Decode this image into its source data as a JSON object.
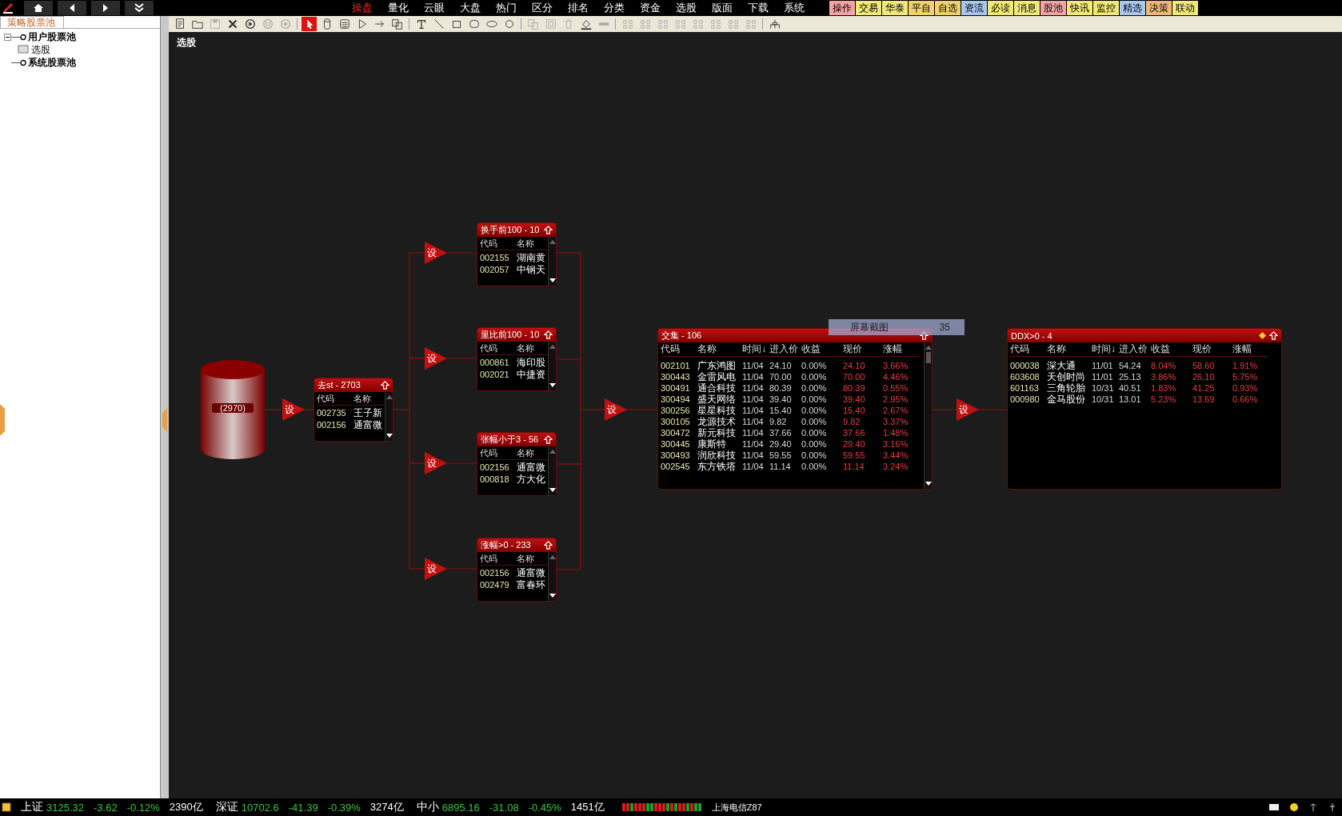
{
  "menu": {
    "items": [
      {
        "label": "操盘",
        "selected": true
      },
      {
        "label": "量化",
        "selected": false
      },
      {
        "label": "云眼",
        "selected": false
      },
      {
        "label": "大盘",
        "selected": false
      },
      {
        "label": "热门",
        "selected": false
      },
      {
        "label": "区分",
        "selected": false
      },
      {
        "label": "排名",
        "selected": false
      },
      {
        "label": "分类",
        "selected": false
      },
      {
        "label": "资金",
        "selected": false
      },
      {
        "label": "选股",
        "selected": false
      },
      {
        "label": "版面",
        "selected": false
      },
      {
        "label": "下载",
        "selected": false
      },
      {
        "label": "系统",
        "selected": false
      }
    ]
  },
  "quick_tabs": [
    {
      "label": "操作",
      "color": "#f4a4a4"
    },
    {
      "label": "交易",
      "color": "#f0e878"
    },
    {
      "label": "华泰",
      "color": "#f0e878"
    },
    {
      "label": "平自",
      "color": "#f0d070"
    },
    {
      "label": "自选",
      "color": "#f0d070"
    },
    {
      "label": "资流",
      "color": "#a8c8f0"
    },
    {
      "label": "必读",
      "color": "#f0e878"
    },
    {
      "label": "消息",
      "color": "#f0e878"
    },
    {
      "label": "股池",
      "color": "#f4a4a4"
    },
    {
      "label": "快讯",
      "color": "#f0e878"
    },
    {
      "label": "监控",
      "color": "#f0e878"
    },
    {
      "label": "精选",
      "color": "#a8c8f0"
    },
    {
      "label": "决策",
      "color": "#f0b878"
    },
    {
      "label": "联动",
      "color": "#f0e878"
    }
  ],
  "sidebar": {
    "tab": "策略股票池",
    "tree": [
      {
        "label": "用户股票池",
        "expanded": true,
        "children": [
          {
            "label": "选股"
          }
        ]
      },
      {
        "label": "系统股票池"
      }
    ]
  },
  "toolbar": {
    "tools": [
      {
        "kind": "new",
        "selected": false,
        "disabled": false
      },
      {
        "kind": "open",
        "selected": false,
        "disabled": false
      },
      {
        "kind": "save",
        "selected": false,
        "disabled": true
      },
      {
        "kind": "close",
        "selected": false,
        "disabled": false
      },
      {
        "kind": "run",
        "selected": false,
        "disabled": false
      },
      {
        "kind": "pause",
        "selected": false,
        "disabled": true
      },
      {
        "kind": "stop",
        "selected": false,
        "disabled": true
      },
      {
        "kind": "pointer",
        "selected": true,
        "disabled": false
      },
      {
        "kind": "cylinder",
        "selected": false,
        "disabled": false
      },
      {
        "kind": "list",
        "selected": false,
        "disabled": false
      },
      {
        "kind": "triangle",
        "selected": false,
        "disabled": false
      },
      {
        "kind": "arrow",
        "selected": false,
        "disabled": false
      },
      {
        "kind": "copy",
        "selected": false,
        "disabled": false
      },
      {
        "kind": "text",
        "selected": false,
        "disabled": false
      },
      {
        "kind": "line",
        "selected": false,
        "disabled": false
      },
      {
        "kind": "rect",
        "selected": false,
        "disabled": false
      },
      {
        "kind": "roundrect",
        "selected": false,
        "disabled": false
      },
      {
        "kind": "ellipse",
        "selected": false,
        "disabled": false
      },
      {
        "kind": "circle",
        "selected": false,
        "disabled": false
      },
      {
        "kind": "copy",
        "selected": false,
        "disabled": true
      },
      {
        "kind": "paste",
        "selected": false,
        "disabled": true
      },
      {
        "kind": "delete",
        "selected": false,
        "disabled": true
      },
      {
        "kind": "fill",
        "selected": false,
        "disabled": false
      },
      {
        "kind": "bar",
        "selected": false,
        "disabled": true
      },
      {
        "kind": "align",
        "selected": false,
        "disabled": true
      },
      {
        "kind": "align",
        "selected": false,
        "disabled": true
      },
      {
        "kind": "align",
        "selected": false,
        "disabled": true
      },
      {
        "kind": "align",
        "selected": false,
        "disabled": true
      },
      {
        "kind": "align",
        "selected": false,
        "disabled": true
      },
      {
        "kind": "align",
        "selected": false,
        "disabled": true
      },
      {
        "kind": "align",
        "selected": false,
        "disabled": true
      },
      {
        "kind": "align",
        "selected": false,
        "disabled": true
      },
      {
        "kind": "tree",
        "selected": false,
        "disabled": false
      }
    ]
  },
  "canvas": {
    "title": "选股"
  },
  "diagram": {
    "nodes": [
      {
        "kind": "source",
        "label": "(2970)"
      },
      {
        "kind": "gate",
        "label": "设"
      },
      {
        "kind": "list",
        "title": "去st - 2703",
        "columns": [
          "代码",
          "名称"
        ],
        "rows": [
          [
            "002735",
            "王子新"
          ],
          [
            "002156",
            "通富微"
          ]
        ]
      },
      {
        "kind": "gate",
        "label": "设"
      },
      {
        "kind": "list",
        "title": "换手前100 - 10",
        "columns": [
          "代码",
          "名称"
        ],
        "rows": [
          [
            "002155",
            "湖南黄"
          ],
          [
            "002057",
            "中钢天"
          ]
        ]
      },
      {
        "kind": "gate",
        "label": "设"
      },
      {
        "kind": "list",
        "title": "里比前100 - 10",
        "columns": [
          "代码",
          "名称"
        ],
        "rows": [
          [
            "000861",
            "海印股"
          ],
          [
            "002021",
            "中捷资"
          ]
        ]
      },
      {
        "kind": "gate",
        "label": "设"
      },
      {
        "kind": "list",
        "title": "张幅小于3 - 56",
        "columns": [
          "代码",
          "名称"
        ],
        "rows": [
          [
            "002156",
            "通富微"
          ],
          [
            "000818",
            "方大化"
          ]
        ]
      },
      {
        "kind": "gate",
        "label": "设"
      },
      {
        "kind": "list",
        "title": "涨幅>0 - 233",
        "columns": [
          "代码",
          "名称"
        ],
        "rows": [
          [
            "002156",
            "通富微"
          ],
          [
            "002479",
            "富春环"
          ]
        ]
      },
      {
        "kind": "gate",
        "label": "设"
      },
      {
        "kind": "table",
        "title": "交集 - 106",
        "columns": [
          {
            "label": "代码",
            "kind": "code"
          },
          {
            "label": "名称",
            "kind": "name"
          },
          {
            "label": "时间↓",
            "kind": "plain"
          },
          {
            "label": "进入价",
            "kind": "plain"
          },
          {
            "label": "收益",
            "kind": "plain"
          },
          {
            "label": "现价",
            "kind": "up"
          },
          {
            "label": "涨幅",
            "kind": "up"
          }
        ],
        "rows": [
          [
            "002101",
            "广东鸿图",
            "11/04",
            "24.10",
            "0.00%",
            "24.10",
            "3.66%"
          ],
          [
            "300443",
            "金雷风电",
            "11/04",
            "70.00",
            "0.00%",
            "70.00",
            "4.46%"
          ],
          [
            "300491",
            "通合科技",
            "11/04",
            "80.39",
            "0.00%",
            "80.39",
            "0.55%"
          ],
          [
            "300494",
            "盛天网络",
            "11/04",
            "39.40",
            "0.00%",
            "39.40",
            "2.95%"
          ],
          [
            "300256",
            "星星科技",
            "11/04",
            "15.40",
            "0.00%",
            "15.40",
            "2.67%"
          ],
          [
            "300105",
            "龙源技术",
            "11/04",
            "9.82",
            "0.00%",
            "9.82",
            "3.37%"
          ],
          [
            "300472",
            "新元科技",
            "11/04",
            "37.66",
            "0.00%",
            "37.66",
            "1.48%"
          ],
          [
            "300445",
            "康斯特",
            "11/04",
            "29.40",
            "0.00%",
            "29.40",
            "3.16%"
          ],
          [
            "300493",
            "润欣科技",
            "11/04",
            "59.55",
            "0.00%",
            "59.55",
            "3.44%"
          ],
          [
            "002545",
            "东方铁塔",
            "11/04",
            "11.14",
            "0.00%",
            "11.14",
            "3.24%"
          ]
        ]
      },
      {
        "kind": "gate",
        "label": "设"
      },
      {
        "kind": "table",
        "title": "DDX>0 - 4",
        "columns": [
          {
            "label": "代码",
            "kind": "code"
          },
          {
            "label": "名称",
            "kind": "name"
          },
          {
            "label": "时间↓",
            "kind": "plain"
          },
          {
            "label": "进入价",
            "kind": "plain"
          },
          {
            "label": "收益",
            "kind": "up"
          },
          {
            "label": "现价",
            "kind": "up"
          },
          {
            "label": "涨幅",
            "kind": "up"
          }
        ],
        "rows": [
          [
            "000038",
            "深大通",
            "11/01",
            "54.24",
            "8.04%",
            "58.60",
            "1.91%"
          ],
          [
            "603608",
            "天创时尚",
            "11/01",
            "25.13",
            "3.86%",
            "26.10",
            "5.75%"
          ],
          [
            "601163",
            "三角轮胎",
            "10/31",
            "40.51",
            "1.83%",
            "41.25",
            "0.93%"
          ],
          [
            "000980",
            "金马股份",
            "10/31",
            "13.01",
            "5.23%",
            "13.69",
            "0.66%"
          ]
        ]
      }
    ],
    "tooltip": {
      "label": "屏幕截图",
      "value": "35"
    }
  },
  "status_bar": {
    "indices": [
      {
        "name": "上证",
        "value": "3125.32",
        "change": "-3.62",
        "percent": "-0.12%",
        "amount": "2390亿"
      },
      {
        "name": "深证",
        "value": "10702.6",
        "change": "-41.39",
        "percent": "-0.39%",
        "amount": "3274亿"
      },
      {
        "name": "中小",
        "value": "6895.16",
        "change": "-31.08",
        "percent": "-0.45%",
        "amount": "1451亿"
      }
    ],
    "connection": "上海电信Z87"
  }
}
